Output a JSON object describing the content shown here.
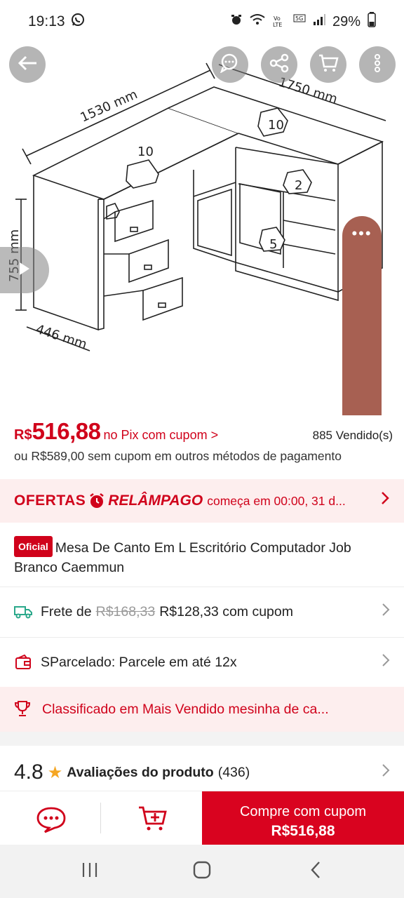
{
  "status_bar": {
    "time": "19:13",
    "battery": "29%",
    "icons": [
      "whatsapp-icon",
      "alarm-icon",
      "wifi-icon",
      "volte-icon",
      "5g-icon",
      "signal-icon",
      "battery-icon"
    ]
  },
  "image": {
    "dimensions": {
      "width_a": "1530 mm",
      "width_b": "1750 mm",
      "height": "755 mm",
      "depth": "446 mm"
    },
    "load_labels": [
      "10",
      "10",
      "2",
      "5"
    ]
  },
  "price": {
    "currency": "R$",
    "value": "516,88",
    "pix_text": "no Pix com cupom >",
    "sold": "885 Vendido(s)",
    "alt": "ou R$589,00 sem cupom em outros métodos de pagamento"
  },
  "flash": {
    "ofertas": "OFERTAS",
    "relampago": "RELÂMPAGO",
    "starts": "começa em 00:00, 31 d..."
  },
  "product": {
    "badge": "Oficial",
    "title": "Mesa De Canto Em L Escritório Computador Job Branco Caemmun"
  },
  "shipping": {
    "label": "Frete de",
    "old_price": "R$168,33",
    "new_price": "R$128,33 com cupom"
  },
  "installments": {
    "text": "SParcelado: Parcele em até 12x"
  },
  "ranking": {
    "text": "Classificado em Mais Vendido mesinha de ca..."
  },
  "rating": {
    "score": "4.8",
    "label": "Avaliações do produto",
    "count": "(436)"
  },
  "bottom": {
    "buy_line1": "Compre com cupom",
    "buy_line2": "R$516,88"
  },
  "colors": {
    "accent": "#d0021b",
    "accent_bg": "#fdeeee",
    "float_panel": "#a76052",
    "star": "#f5a623"
  }
}
